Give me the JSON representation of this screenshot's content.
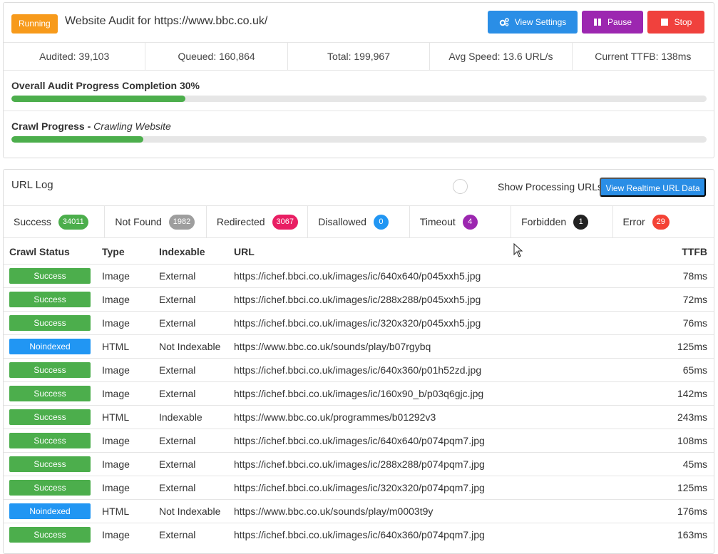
{
  "header": {
    "status_badge": "Running",
    "title": "Website Audit for https://www.bbc.co.uk/",
    "buttons": {
      "settings": "View Settings",
      "pause": "Pause",
      "stop": "Stop"
    },
    "colors": {
      "running": "#f79a1b",
      "settings": "#2a8ee6",
      "pause": "#9c27b0",
      "stop": "#f0413d"
    }
  },
  "stats": {
    "audited": "Audited: 39,103",
    "queued": "Queued: 160,864",
    "total": "Total: 199,967",
    "avg_speed": "Avg Speed: 13.6 URL/s",
    "ttfb": "Current TTFB:  138ms"
  },
  "progress": {
    "overall_label": "Overall Audit Progress Completion 30%",
    "overall_percent": 25,
    "crawl_label": "Crawl Progress",
    "crawl_sub": "Crawling Website",
    "crawl_percent": 19
  },
  "log": {
    "title": "URL Log",
    "processing_label": "Show Processing URLs",
    "realtime_button": "View Realtime URL Data",
    "tabs": [
      {
        "label": "Success",
        "count": "34011",
        "color": "#4cae4c"
      },
      {
        "label": "Not Found",
        "count": "1982",
        "color": "#9e9e9e"
      },
      {
        "label": "Redirected",
        "count": "3067",
        "color": "#e91e63"
      },
      {
        "label": "Disallowed",
        "count": "0",
        "color": "#2196f3"
      },
      {
        "label": "Timeout",
        "count": "4",
        "color": "#9c27b0"
      },
      {
        "label": "Forbidden",
        "count": "1",
        "color": "#222222"
      },
      {
        "label": "Error",
        "count": "29",
        "color": "#f44336"
      }
    ],
    "columns": {
      "status": "Crawl Status",
      "type": "Type",
      "indexable": "Indexable",
      "url": "URL",
      "ttfb": "TTFB"
    },
    "status_colors": {
      "Success": "#4cae4c",
      "Noindexed": "#2196f3"
    },
    "rows": [
      {
        "status": "Success",
        "type": "Image",
        "indexable": "External",
        "url": "https://ichef.bbci.co.uk/images/ic/640x640/p045xxh5.jpg",
        "ttfb": "78ms"
      },
      {
        "status": "Success",
        "type": "Image",
        "indexable": "External",
        "url": "https://ichef.bbci.co.uk/images/ic/288x288/p045xxh5.jpg",
        "ttfb": "72ms"
      },
      {
        "status": "Success",
        "type": "Image",
        "indexable": "External",
        "url": "https://ichef.bbci.co.uk/images/ic/320x320/p045xxh5.jpg",
        "ttfb": "76ms"
      },
      {
        "status": "Noindexed",
        "type": "HTML",
        "indexable": "Not Indexable",
        "url": "https://www.bbc.co.uk/sounds/play/b07rgybq",
        "ttfb": "125ms"
      },
      {
        "status": "Success",
        "type": "Image",
        "indexable": "External",
        "url": "https://ichef.bbci.co.uk/images/ic/640x360/p01h52zd.jpg",
        "ttfb": "65ms"
      },
      {
        "status": "Success",
        "type": "Image",
        "indexable": "External",
        "url": "https://ichef.bbci.co.uk/images/ic/160x90_b/p03q6gjc.jpg",
        "ttfb": "142ms"
      },
      {
        "status": "Success",
        "type": "HTML",
        "indexable": "Indexable",
        "url": "https://www.bbc.co.uk/programmes/b01292v3",
        "ttfb": "243ms"
      },
      {
        "status": "Success",
        "type": "Image",
        "indexable": "External",
        "url": "https://ichef.bbci.co.uk/images/ic/640x640/p074pqm7.jpg",
        "ttfb": "108ms"
      },
      {
        "status": "Success",
        "type": "Image",
        "indexable": "External",
        "url": "https://ichef.bbci.co.uk/images/ic/288x288/p074pqm7.jpg",
        "ttfb": "45ms"
      },
      {
        "status": "Success",
        "type": "Image",
        "indexable": "External",
        "url": "https://ichef.bbci.co.uk/images/ic/320x320/p074pqm7.jpg",
        "ttfb": "125ms"
      },
      {
        "status": "Noindexed",
        "type": "HTML",
        "indexable": "Not Indexable",
        "url": "https://www.bbc.co.uk/sounds/play/m0003t9y",
        "ttfb": "176ms"
      },
      {
        "status": "Success",
        "type": "Image",
        "indexable": "External",
        "url": "https://ichef.bbci.co.uk/images/ic/640x360/p074pqm7.jpg",
        "ttfb": "163ms"
      }
    ]
  }
}
